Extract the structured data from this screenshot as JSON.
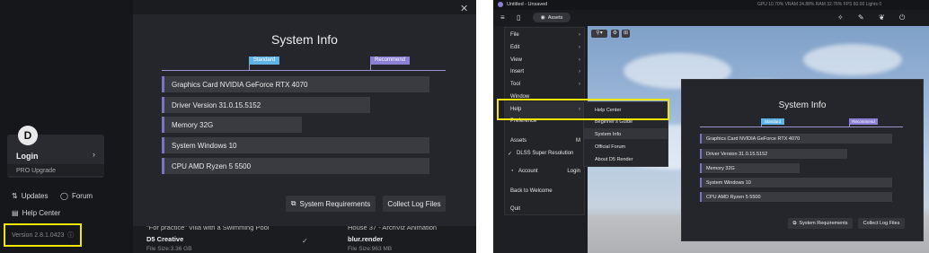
{
  "left": {
    "avatar_letter": "D",
    "login_label": "Login",
    "pro_label": "PRO Upgrade",
    "updates_label": "Updates",
    "forum_label": "Forum",
    "help_center_label": "Help Center",
    "version_label": "Version 2.8.1.0423",
    "bg_cards": [
      {
        "title": "\"For practice\" Villa with a Swimming Pool",
        "sub": "D5 Creative",
        "meta": "File Size:3.36 GB"
      },
      {
        "title": "House 37 - ArchViz Animation",
        "sub": "blur.render",
        "meta": "File Size:963 MB"
      }
    ]
  },
  "system_info": {
    "title": "System Info",
    "standard_tab": "Standard",
    "recommend_tab": "Recommend",
    "rows": [
      "Graphics Card  NVIDIA GeForce RTX 4070",
      "Driver Version  31.0.15.5152",
      "Memory  32G",
      "System  Windows 10",
      "CPU  AMD Ryzen 5 5500"
    ],
    "btn_requirements": "System Requirements",
    "btn_logs": "Collect Log Files"
  },
  "right": {
    "window_title": "Untitled - Unsaved",
    "assets_button": "Assets",
    "stats": "GPU 10.70%   VRAM 24.88%   RAM 32.76%   FPS 60.00   Lights 0",
    "menu_items": [
      "File",
      "Edit",
      "View",
      "Insert",
      "Tool",
      "Window",
      "Help",
      "Preference",
      "Assets",
      "DLSS Super Resolution",
      "Account",
      "Login",
      "Back to Welcome",
      "Quit"
    ],
    "assets_shortcut": "M",
    "submenu_items": [
      "Help Center",
      "Beginner's Guide",
      "System Info",
      "Official Forum",
      "About D5 Render"
    ]
  },
  "colors": {
    "highlight": "#f2e600",
    "standard": "#5fb3e6",
    "recommend": "#8b7fd6",
    "panel": "#25262b"
  }
}
